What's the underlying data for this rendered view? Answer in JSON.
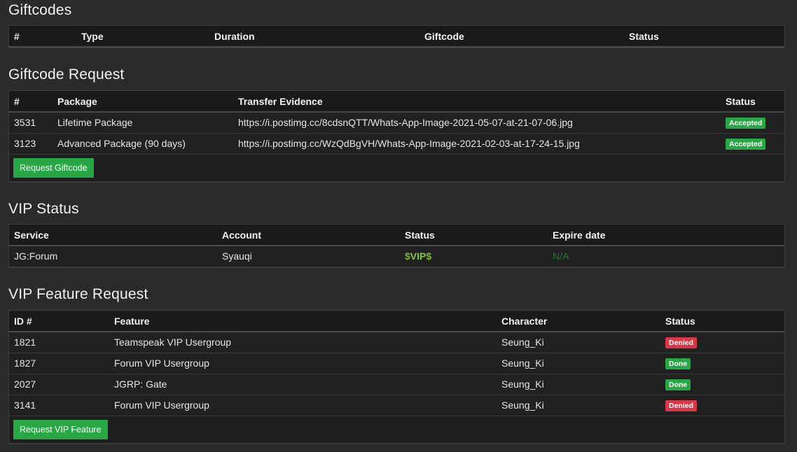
{
  "giftcodes": {
    "title": "Giftcodes",
    "columns": [
      "#",
      "Type",
      "Duration",
      "Giftcode",
      "Status"
    ]
  },
  "giftcode_request": {
    "title": "Giftcode Request",
    "columns": [
      "#",
      "Package",
      "Transfer Evidence",
      "Status"
    ],
    "rows": [
      {
        "id": "3531",
        "package": "Lifetime Package",
        "evidence": "https://i.postimg.cc/8cdsnQTT/Whats-App-Image-2021-05-07-at-21-07-06.jpg",
        "status": "Accepted"
      },
      {
        "id": "3123",
        "package": "Advanced Package (90 days)",
        "evidence": "https://i.postimg.cc/WzQdBgVH/Whats-App-Image-2021-02-03-at-17-24-15.jpg",
        "status": "Accepted"
      }
    ],
    "button_label": "Request Giftcode"
  },
  "vip_status": {
    "title": "VIP Status",
    "columns": [
      "Service",
      "Account",
      "Status",
      "Expire date"
    ],
    "row": {
      "service": "JG:Forum",
      "account": "Syauqi",
      "status_prefix": "$",
      "status_main": "VIP",
      "status_suffix": "$",
      "expire": "N/A"
    }
  },
  "vip_feature_request": {
    "title": "VIP Feature Request",
    "columns": [
      "ID #",
      "Feature",
      "Character",
      "Status"
    ],
    "rows": [
      {
        "id": "1821",
        "feature": "Teamspeak VIP Usergroup",
        "character": "Seung_Ki",
        "status": "Denied"
      },
      {
        "id": "1827",
        "feature": "Forum VIP Usergroup",
        "character": "Seung_Ki",
        "status": "Done"
      },
      {
        "id": "2027",
        "feature": "JGRP: Gate",
        "character": "Seung_Ki",
        "status": "Done"
      },
      {
        "id": "3141",
        "feature": "Forum VIP Usergroup",
        "character": "Seung_Ki",
        "status": "Denied"
      }
    ],
    "button_label": "Request VIP Feature"
  },
  "colors": {
    "success": "#28a745",
    "danger": "#dc3545",
    "vip_green": "#8bc34a"
  }
}
